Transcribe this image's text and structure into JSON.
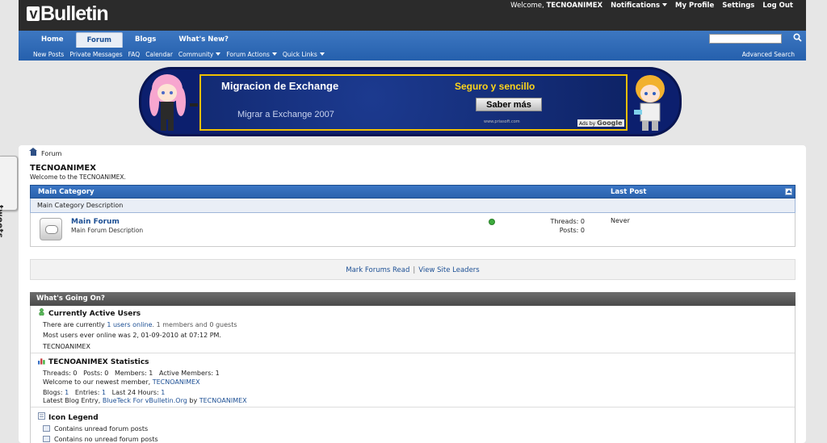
{
  "logo": {
    "text": "Bulletin",
    "mark": "v"
  },
  "top_links": {
    "welcome": "Welcome,",
    "username": "TECNOANIMEX",
    "notifications": "Notifications",
    "my_profile": "My Profile",
    "settings": "Settings",
    "logout": "Log Out"
  },
  "tabs": [
    {
      "label": "Home"
    },
    {
      "label": "Forum"
    },
    {
      "label": "Blogs"
    },
    {
      "label": "What's New?"
    }
  ],
  "active_tab": "Forum",
  "subnav": {
    "new_posts": "New Posts",
    "private_messages": "Private Messages",
    "faq": "FAQ",
    "calendar": "Calendar",
    "community": "Community",
    "forum_actions": "Forum Actions",
    "quick_links": "Quick Links",
    "advanced_search": "Advanced Search"
  },
  "search": {
    "value": ""
  },
  "banner": {
    "title": "Migracion de Exchange",
    "subtitle": "Migrar a Exchange 2007",
    "tagline": "Seguro y sencillo",
    "button": "Saber más",
    "url": "www.priasoft.com",
    "ads_by": "Ads by",
    "google": "Google"
  },
  "side_tab": {
    "label": "tweets"
  },
  "breadcrumb": {
    "label": "Forum"
  },
  "site": {
    "title": "TECNOANIMEX",
    "welcome": "Welcome to the TECNOANIMEX."
  },
  "category": {
    "name": "Main Category",
    "last_post_header": "Last Post",
    "description": "Main Category Description"
  },
  "forum": {
    "name": "Main Forum",
    "description": "Main Forum Description",
    "threads": "Threads: 0",
    "posts": "Posts: 0",
    "last_post": "Never"
  },
  "actions": {
    "mark_read": "Mark Forums Read",
    "separator": "|",
    "site_leaders": "View Site Leaders"
  },
  "wgo": {
    "title": "What's Going On?",
    "active": {
      "heading": "Currently Active Users",
      "line1_a": "There are currently",
      "line1_link": "1 users online",
      "line1_b": ". 1 members and 0 guests",
      "line2": "Most users ever online was 2, 01-09-2010 at 07:12 PM.",
      "user": "TECNOANIMEX"
    },
    "stats": {
      "heading": "TECNOANIMEX Statistics",
      "line1": "Threads: 0   Posts: 0   Members: 1   Active Members: 1",
      "line2_a": "Welcome to our newest member,",
      "line2_link": "TECNOANIMEX",
      "line3_a": "Blogs:",
      "line3_blogs": "1",
      "line3_b": "Entries:",
      "line3_entries": "1",
      "line3_c": "Last 24 Hours:",
      "line3_24": "1",
      "line4_a": "Latest Blog Entry,",
      "line4_link": "BlueTeck For vBulletin.Org",
      "line4_by": "by",
      "line4_user": "TECNOANIMEX"
    },
    "legend": {
      "heading": "Icon Legend",
      "item1": "Contains unread forum posts",
      "item2": "Contains no unread forum posts"
    }
  }
}
